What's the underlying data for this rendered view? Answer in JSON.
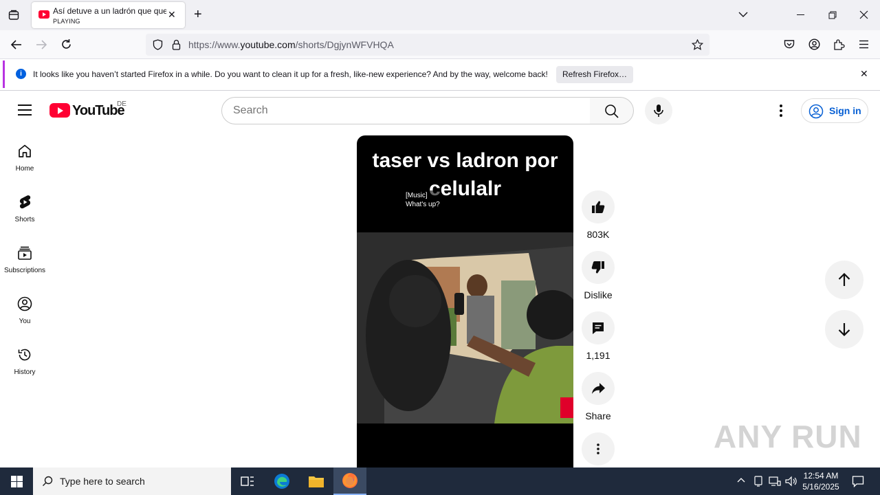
{
  "browser": {
    "tab": {
      "title": "Así detuve a un ladrón que quería robar mi celular",
      "status": "PLAYING"
    },
    "url": {
      "prefix": "https://www.",
      "domain": "youtube.com",
      "path": "/shorts/DgjynWFVHQA"
    },
    "notification": {
      "message": "It looks like you haven’t started Firefox in a while. Do you want to clean it up for a fresh, like-new experience? And by the way, welcome back!",
      "button": "Refresh Firefox…"
    }
  },
  "youtube": {
    "logo_text": "YouTube",
    "country_code": "DE",
    "search_placeholder": "Search",
    "sign_in": "Sign in",
    "sidebar": [
      {
        "label": "Home"
      },
      {
        "label": "Shorts"
      },
      {
        "label": "Subscriptions"
      },
      {
        "label": "You"
      },
      {
        "label": "History"
      }
    ],
    "short": {
      "caption": "taser vs ladron por celulalr",
      "subtitles_line1": "[Music]",
      "subtitles_line2": "What's up?"
    },
    "actions": {
      "likes": "803K",
      "dislike": "Dislike",
      "comments": "1,191",
      "share": "Share"
    },
    "colors": {
      "brand_red": "#ff0033",
      "link_blue": "#065fd4"
    }
  },
  "watermark": "ANY RUN",
  "taskbar": {
    "search_placeholder": "Type here to search",
    "time": "12:54 AM",
    "date": "5/16/2025"
  }
}
